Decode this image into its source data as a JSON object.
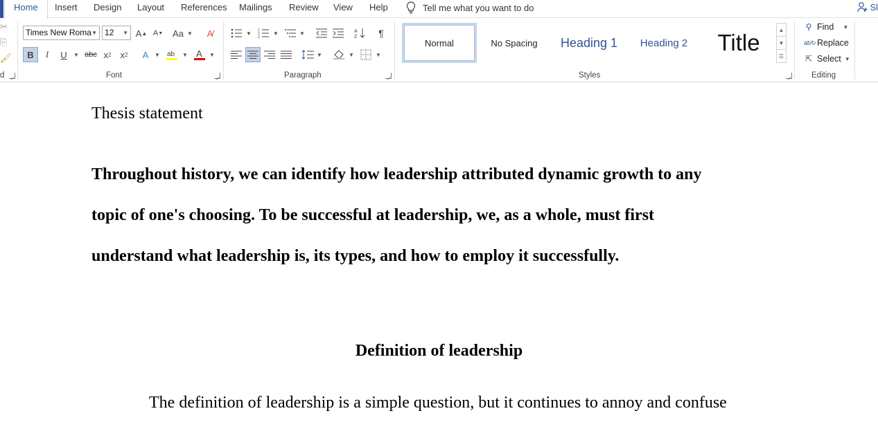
{
  "tabs": [
    "Home",
    "Insert",
    "Design",
    "Layout",
    "References",
    "Mailings",
    "Review",
    "View",
    "Help"
  ],
  "tell_me": "Tell me what you want to do",
  "share_label": "Sl",
  "font": {
    "name": "Times New Roma",
    "size": "12",
    "group_label": "Font"
  },
  "paragraph": {
    "group_label": "Paragraph"
  },
  "styles": {
    "group_label": "Styles",
    "items": [
      "Normal",
      "No Spacing",
      "Heading 1",
      "Heading 2",
      "Title"
    ]
  },
  "editing": {
    "group_label": "Editing",
    "find": "Find",
    "replace": "Replace",
    "select": "Select"
  },
  "clipboard": {
    "group_label": "d"
  },
  "colors": {
    "accent": "#2b579a",
    "highlight": "#ffff00",
    "font_color": "#e00000"
  },
  "document": {
    "thesis_title": "Thesis statement",
    "bold_paragraph_lines": [
      "Throughout history, we can identify how leadership attributed dynamic growth to any",
      "topic of one's choosing. To be successful at leadership, we, as a whole, must first",
      "understand what leadership is, its types, and how to employ it successfully."
    ],
    "section_heading": "Definition of leadership",
    "body_first_line": "The definition of leadership is a simple question, but it continues to annoy and confuse"
  }
}
